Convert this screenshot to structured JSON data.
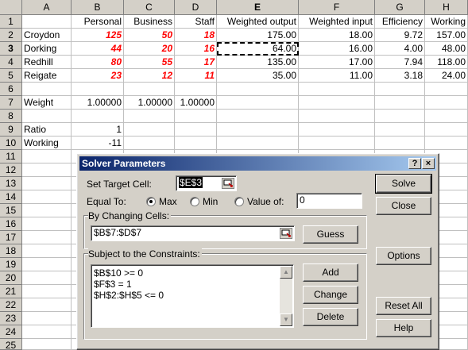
{
  "sheet": {
    "columns": [
      "A",
      "B",
      "C",
      "D",
      "E",
      "F",
      "G",
      "H"
    ],
    "selected_column": "E",
    "selected_row": "3",
    "rows": [
      "1",
      "2",
      "3",
      "4",
      "5",
      "6",
      "7",
      "8",
      "9",
      "10",
      "11",
      "12",
      "13",
      "14",
      "15",
      "16",
      "17",
      "18",
      "19",
      "20",
      "21",
      "22",
      "23",
      "24",
      "25"
    ],
    "header_row": [
      "",
      "Personal",
      "Business",
      "Staff",
      "Weighted output",
      "Weighted input",
      "Efficiency",
      "Working"
    ],
    "data_rows": [
      [
        "Croydon",
        "125",
        "50",
        "18",
        "175.00",
        "18.00",
        "9.72",
        "157.00"
      ],
      [
        "Dorking",
        "44",
        "20",
        "16",
        "64.00",
        "16.00",
        "4.00",
        "48.00"
      ],
      [
        "Redhill",
        "80",
        "55",
        "17",
        "135.00",
        "17.00",
        "7.94",
        "118.00"
      ],
      [
        "Reigate",
        "23",
        "12",
        "11",
        "35.00",
        "11.00",
        "3.18",
        "24.00"
      ]
    ],
    "weight_row": [
      "Weight",
      "1.00000",
      "1.00000",
      "1.00000"
    ],
    "ratio_row": [
      "Ratio",
      "1"
    ],
    "working_row": [
      "Working",
      "-11"
    ],
    "input_color": "#ff0000"
  },
  "dialog": {
    "title": "Solver Parameters",
    "help_glyph": "?",
    "close_glyph": "×",
    "target_label": "Set Target Cell:",
    "target_value": "$E$3",
    "equal_to_label": "Equal To:",
    "options": [
      {
        "label": "Max",
        "checked": true
      },
      {
        "label": "Min",
        "checked": false
      },
      {
        "label": "Value of:",
        "checked": false
      }
    ],
    "value_of": "0",
    "changing_label": "By Changing Cells:",
    "changing_value": "$B$7:$D$7",
    "constraints_label": "Subject to the Constraints:",
    "constraints": [
      "$B$10 >= 0",
      "$F$3 = 1",
      "$H$2:$H$5 <= 0"
    ],
    "buttons": {
      "solve": "Solve",
      "close": "Close",
      "guess": "Guess",
      "options": "Options",
      "add": "Add",
      "change": "Change",
      "delete": "Delete",
      "reset": "Reset All",
      "help": "Help"
    },
    "title_gradient": [
      "#0a246a",
      "#a6caf0"
    ]
  }
}
